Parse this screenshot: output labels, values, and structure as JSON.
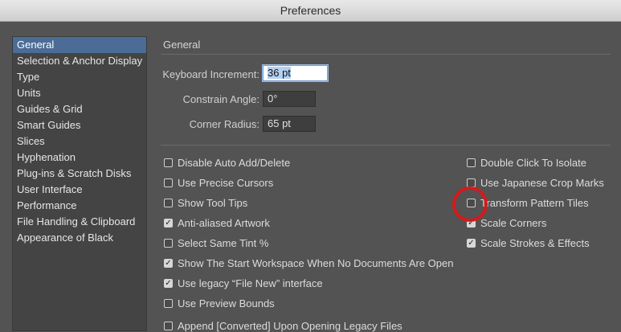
{
  "window": {
    "title": "Preferences"
  },
  "sidebar": {
    "items": [
      {
        "label": "General",
        "selected": true
      },
      {
        "label": "Selection & Anchor Display"
      },
      {
        "label": "Type"
      },
      {
        "label": "Units"
      },
      {
        "label": "Guides & Grid"
      },
      {
        "label": "Smart Guides"
      },
      {
        "label": "Slices"
      },
      {
        "label": "Hyphenation"
      },
      {
        "label": "Plug-ins & Scratch Disks"
      },
      {
        "label": "User Interface"
      },
      {
        "label": "Performance"
      },
      {
        "label": "File Handling & Clipboard"
      },
      {
        "label": "Appearance of Black"
      }
    ]
  },
  "main": {
    "section_title": "General",
    "fields": {
      "keyboard_increment": {
        "label": "Keyboard Increment:",
        "value": "36 pt"
      },
      "constrain_angle": {
        "label": "Constrain Angle:",
        "value": "0°"
      },
      "corner_radius": {
        "label": "Corner Radius:",
        "value": "65 pt"
      }
    },
    "left_options": [
      {
        "label": "Disable Auto Add/Delete",
        "checked": false
      },
      {
        "label": "Use Precise Cursors",
        "checked": false
      },
      {
        "label": "Show Tool Tips",
        "checked": false
      },
      {
        "label": "Anti-aliased Artwork",
        "checked": true
      },
      {
        "label": "Select Same Tint %",
        "checked": false
      },
      {
        "label": "Show The Start Workspace When No Documents Are Open",
        "checked": true
      },
      {
        "label": "Use legacy “File New” interface",
        "checked": true
      },
      {
        "label": "Use Preview Bounds",
        "checked": false
      },
      {
        "label": "Append [Converted] Upon Opening Legacy Files",
        "checked": false
      }
    ],
    "right_options": [
      {
        "label": "Double Click To Isolate",
        "checked": false
      },
      {
        "label": "Use Japanese Crop Marks",
        "checked": false
      },
      {
        "label": "Transform Pattern Tiles",
        "checked": false
      },
      {
        "label": "Scale Corners",
        "checked": true
      },
      {
        "label": "Scale Strokes & Effects",
        "checked": true
      }
    ]
  },
  "colors": {
    "background": "#535353",
    "sidebar_selected": "#4a6c96",
    "annotation_ring": "#d41a1a"
  },
  "icons": {
    "check": "checkmark-icon"
  }
}
